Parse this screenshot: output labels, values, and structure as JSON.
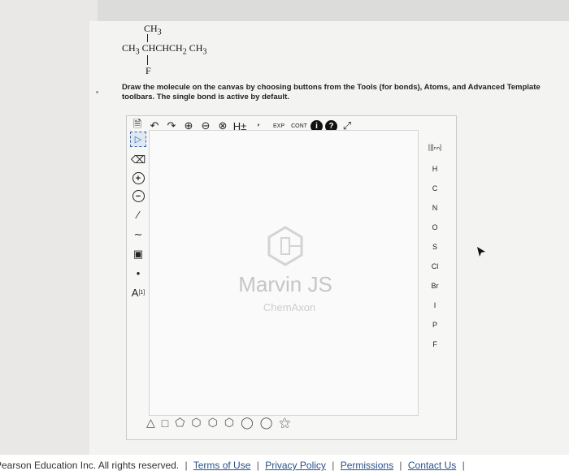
{
  "question": {
    "formula": {
      "top_group": "CH3",
      "chain_parts": [
        "CH3",
        "CHCHCH2",
        "CH3"
      ],
      "bottom_atom": "F"
    },
    "instruction": "Draw the molecule on the canvas by choosing buttons from the Tools (for bonds), Atoms, and Advanced Template toolbars. The single bond is active by default."
  },
  "editor": {
    "top_toolbar": {
      "hydrogen_label": "H±",
      "expand_label": "EXP",
      "contract_label": "CONT",
      "info_label": "i",
      "help_label": "?"
    },
    "left_toolbar": {
      "charge_label": "A",
      "charge_superscript": "[1]"
    },
    "atoms": [
      "H",
      "C",
      "N",
      "O",
      "S",
      "Cl",
      "Br",
      "I",
      "P",
      "F"
    ],
    "periodic_table_label": "|||ₙₙ|",
    "watermark": {
      "title": "Marvin JS",
      "by": "ChemAxon"
    }
  },
  "footer": {
    "copyright": "Pearson Education Inc. All rights reserved.",
    "links": [
      "Terms of Use",
      "Privacy Policy",
      "Permissions",
      "Contact Us"
    ]
  }
}
